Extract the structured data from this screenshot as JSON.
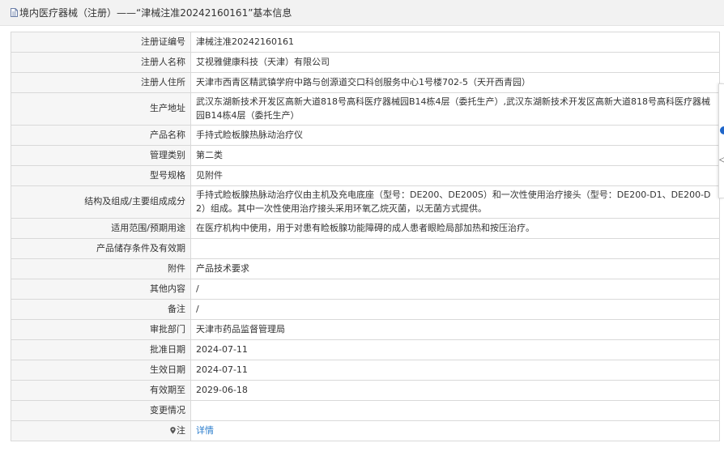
{
  "header": {
    "title": "境内医疗器械（注册）——“津械注准20242160161”基本信息"
  },
  "rows": [
    {
      "label": "注册证编号",
      "value": "津械注准20242160161"
    },
    {
      "label": "注册人名称",
      "value": "艾视雅健康科技（天津）有限公司"
    },
    {
      "label": "注册人住所",
      "value": "天津市西青区精武镇学府中路与创源道交口科创服务中心1号楼702-5（天开西青园）"
    },
    {
      "label": "生产地址",
      "value": "武汉东湖新技术开发区高新大道818号高科医疗器械园B14栋4层（委托生产）,武汉东湖新技术开发区高新大道818号高科医疗器械园B14栋4层（委托生产）"
    },
    {
      "label": "产品名称",
      "value": "手持式睑板腺热脉动治疗仪"
    },
    {
      "label": "管理类别",
      "value": "第二类"
    },
    {
      "label": "型号规格",
      "value": "见附件"
    },
    {
      "label": "结构及组成/主要组成成分",
      "value": "手持式睑板腺热脉动治疗仪由主机及充电底座（型号：DE200、DE200S）和一次性使用治疗接头（型号：DE200-D1、DE200-D2）组成。其中一次性使用治疗接头采用环氧乙烷灭菌，以无菌方式提供。"
    },
    {
      "label": "适用范围/预期用途",
      "value": "在医疗机构中使用，用于对患有睑板腺功能障碍的成人患者眼睑局部加热和按压治疗。"
    },
    {
      "label": "产品储存条件及有效期",
      "value": ""
    },
    {
      "label": "附件",
      "value": "产品技术要求"
    },
    {
      "label": "其他内容",
      "value": "/"
    },
    {
      "label": "备注",
      "value": "/"
    },
    {
      "label": "审批部门",
      "value": "天津市药品监督管理局"
    },
    {
      "label": "批准日期",
      "value": "2024-07-11"
    },
    {
      "label": "生效日期",
      "value": "2024-07-11"
    },
    {
      "label": "有效期至",
      "value": "2029-06-18"
    },
    {
      "label": "变更情况",
      "value": ""
    },
    {
      "label": "注",
      "value": "详情"
    }
  ],
  "icons": {
    "header_icon": "document-icon",
    "note_icon": "pin-icon"
  },
  "colors": {
    "link": "#2a7ccc",
    "label_bg": "#f6f6f6",
    "header_bg": "#f2f2f2",
    "border": "#d9d9d9"
  }
}
